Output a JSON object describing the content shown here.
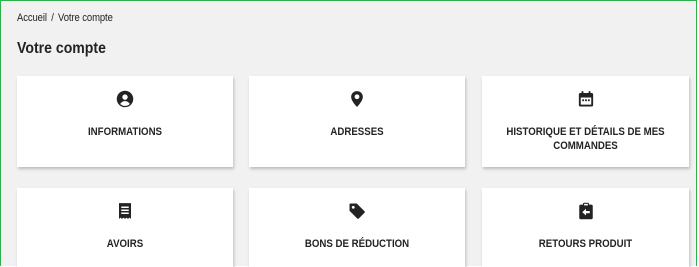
{
  "breadcrumb": {
    "home": "Accueil",
    "separator": "/",
    "current": "Votre compte"
  },
  "page_title": "Votre compte",
  "cards": [
    {
      "label": "INFORMATIONS",
      "icon": "user-circle-icon"
    },
    {
      "label": "ADRESSES",
      "icon": "map-pin-icon"
    },
    {
      "label": "HISTORIQUE ET DÉTAILS DE MES COMMANDES",
      "icon": "calendar-icon"
    },
    {
      "label": "AVOIRS",
      "icon": "receipt-icon"
    },
    {
      "label": "BONS DE RÉDUCTION",
      "icon": "tag-icon"
    },
    {
      "label": "RETOURS PRODUIT",
      "icon": "clipboard-return-icon"
    }
  ],
  "colors": {
    "frame_border": "#2db14a",
    "page_background": "#f1f1f1",
    "card_background": "#ffffff",
    "text": "#232323"
  }
}
